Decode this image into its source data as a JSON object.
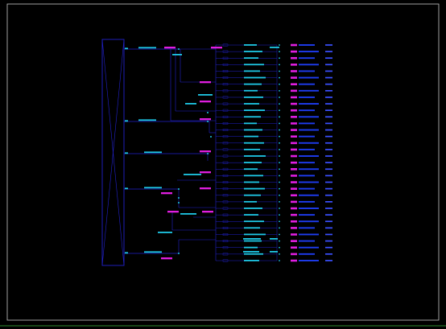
{
  "colors": {
    "background": "#000000",
    "frame": "#c8c8c8",
    "bottom_rule": "#2e8b2e",
    "wire": "#2222cc",
    "label_cyan": "#1ec8e6",
    "label_magenta": "#e01ee0",
    "tag_blue": "#1e3cf0",
    "tag_text": "#1ec8e6",
    "right_label": "#3a50ff"
  },
  "drawing": {
    "title_block": [
      "",
      ""
    ],
    "note_text": ""
  },
  "rows": {
    "count": 34
  }
}
